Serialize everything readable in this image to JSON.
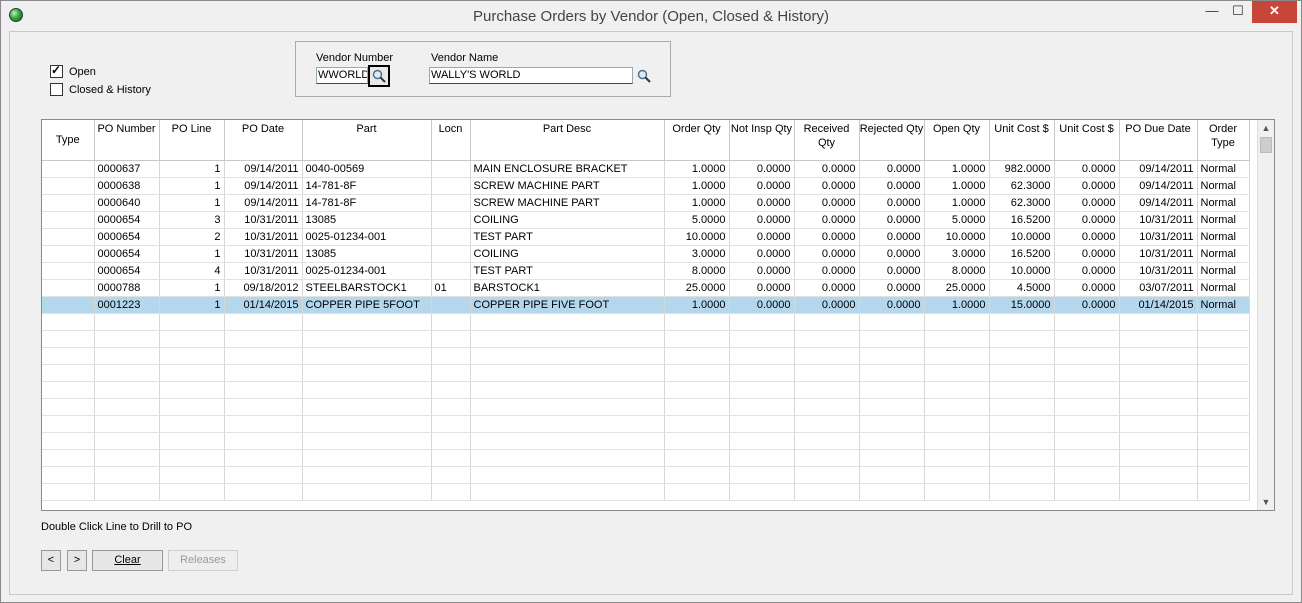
{
  "window": {
    "title": "Purchase Orders by Vendor (Open, Closed & History)",
    "min_glyph": "—",
    "max_glyph": "☐",
    "close_glyph": "✕"
  },
  "filters": {
    "open_label": "Open",
    "open_checked": true,
    "closed_label": "Closed & History",
    "closed_checked": false
  },
  "vendor": {
    "number_label": "Vendor Number",
    "number_value": "WWORLD",
    "name_label": "Vendor Name",
    "name_value": "WALLY'S WORLD"
  },
  "grid": {
    "columns": [
      "Type",
      "PO Number",
      "PO Line",
      "PO Date",
      "Part",
      "Locn",
      "Part Desc",
      "Order Qty",
      "Not Insp Qty",
      "Received Qty",
      "Rejected Qty",
      "Open Qty",
      "Unit Cost $",
      "Unit Cost $",
      "PO Due Date",
      "Order Type"
    ],
    "rows": [
      [
        "",
        "0000637",
        "1",
        "09/14/2011",
        "0040-00569",
        "",
        "MAIN ENCLOSURE BRACKET",
        "1.0000",
        "0.0000",
        "0.0000",
        "0.0000",
        "1.0000",
        "982.0000",
        "0.0000",
        "09/14/2011",
        "Normal"
      ],
      [
        "",
        "0000638",
        "1",
        "09/14/2011",
        "14-781-8F",
        "",
        "SCREW MACHINE PART",
        "1.0000",
        "0.0000",
        "0.0000",
        "0.0000",
        "1.0000",
        "62.3000",
        "0.0000",
        "09/14/2011",
        "Normal"
      ],
      [
        "",
        "0000640",
        "1",
        "09/14/2011",
        "14-781-8F",
        "",
        "SCREW MACHINE PART",
        "1.0000",
        "0.0000",
        "0.0000",
        "0.0000",
        "1.0000",
        "62.3000",
        "0.0000",
        "09/14/2011",
        "Normal"
      ],
      [
        "",
        "0000654",
        "3",
        "10/31/2011",
        "13085",
        "",
        "COILING",
        "5.0000",
        "0.0000",
        "0.0000",
        "0.0000",
        "5.0000",
        "16.5200",
        "0.0000",
        "10/31/2011",
        "Normal"
      ],
      [
        "",
        "0000654",
        "2",
        "10/31/2011",
        "0025-01234-001",
        "",
        "TEST PART",
        "10.0000",
        "0.0000",
        "0.0000",
        "0.0000",
        "10.0000",
        "10.0000",
        "0.0000",
        "10/31/2011",
        "Normal"
      ],
      [
        "",
        "0000654",
        "1",
        "10/31/2011",
        "13085",
        "",
        "COILING",
        "3.0000",
        "0.0000",
        "0.0000",
        "0.0000",
        "3.0000",
        "16.5200",
        "0.0000",
        "10/31/2011",
        "Normal"
      ],
      [
        "",
        "0000654",
        "4",
        "10/31/2011",
        "0025-01234-001",
        "",
        "TEST PART",
        "8.0000",
        "0.0000",
        "0.0000",
        "0.0000",
        "8.0000",
        "10.0000",
        "0.0000",
        "10/31/2011",
        "Normal"
      ],
      [
        "",
        "0000788",
        "1",
        "09/18/2012",
        "STEELBARSTOCK1",
        "01",
        "BARSTOCK1",
        "25.0000",
        "0.0000",
        "0.0000",
        "0.0000",
        "25.0000",
        "4.5000",
        "0.0000",
        "03/07/2011",
        "Normal"
      ],
      [
        "",
        "0001223",
        "1",
        "01/14/2015",
        "COPPER PIPE 5FOOT",
        "",
        "COPPER PIPE FIVE FOOT",
        "1.0000",
        "0.0000",
        "0.0000",
        "0.0000",
        "1.0000",
        "15.0000",
        "0.0000",
        "01/14/2015",
        "Normal"
      ]
    ],
    "selected_row": 8,
    "empty_rows": 11
  },
  "footer": {
    "hint": "Double Click Line to Drill to PO",
    "prev_label": "<",
    "next_label": ">",
    "clear_label": "Clear",
    "releases_label": "Releases"
  }
}
